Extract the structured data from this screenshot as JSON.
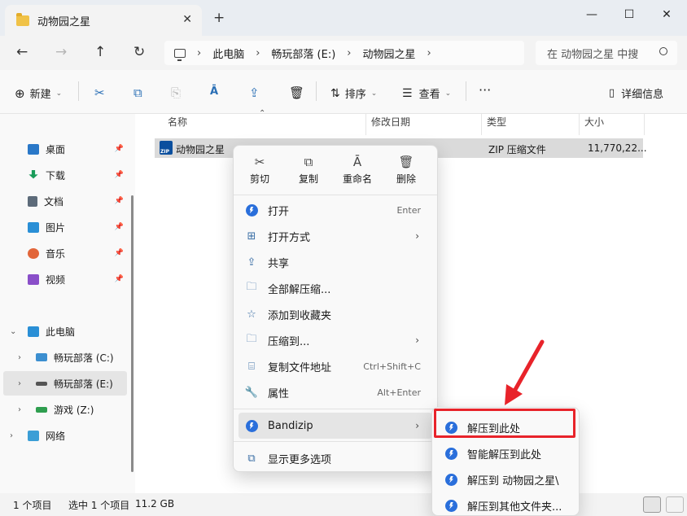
{
  "window": {
    "tab_title": "动物园之星",
    "new_tab": "+",
    "close_tab": "✕",
    "minimize": "—",
    "maximize": "☐",
    "close": "✕"
  },
  "address": {
    "crumbs": [
      "此电脑",
      "畅玩部落 (E:)",
      "动物园之星"
    ],
    "search_placeholder": "在 动物园之星 中搜"
  },
  "toolbar": {
    "new_label": "新建",
    "sort_label": "排序",
    "view_label": "查看",
    "more_label": "···",
    "details_label": "详细信息"
  },
  "sidebar": {
    "quick": [
      {
        "label": "桌面",
        "color": "#2a78c8"
      },
      {
        "label": "下载",
        "color": "#1a9c5a"
      },
      {
        "label": "文档",
        "color": "#5d6b7a"
      },
      {
        "label": "图片",
        "color": "#2a8fd6"
      },
      {
        "label": "音乐",
        "color": "#e2663a"
      },
      {
        "label": "视频",
        "color": "#8a4fc9"
      }
    ],
    "pc_label": "此电脑",
    "drives": [
      "畅玩部落 (C:)",
      "畅玩部落 (E:)",
      "游戏 (Z:)"
    ],
    "network_label": "网络"
  },
  "columns": [
    "名称",
    "修改日期",
    "类型",
    "大小"
  ],
  "file": {
    "name": "动物园之星",
    "type": "ZIP 压缩文件",
    "size": "11,770,22..."
  },
  "context_menu": {
    "quick_actions": [
      "剪切",
      "复制",
      "重命名",
      "删除"
    ],
    "items": [
      {
        "label": "打开",
        "shortcut": "Enter"
      },
      {
        "label": "打开方式",
        "submenu": "›"
      },
      {
        "label": "共享"
      },
      {
        "label": "全部解压缩..."
      },
      {
        "label": "添加到收藏夹"
      },
      {
        "label": "压缩到...",
        "submenu": "›"
      },
      {
        "label": "复制文件地址",
        "shortcut": "Ctrl+Shift+C"
      },
      {
        "label": "属性",
        "shortcut": "Alt+Enter"
      }
    ],
    "bandizip": "Bandizip",
    "bandizip_sub": "›",
    "more_options": "显示更多选项"
  },
  "bandizip_submenu": [
    "解压到此处",
    "智能解压到此处",
    "解压到 动物园之星\\",
    "解压到其他文件夹..."
  ],
  "status": {
    "count": "1 个项目",
    "selected": "选中 1 个项目",
    "size": "11.2 GB"
  },
  "colors": {
    "highlight": "#e8232a",
    "bandizip_blue": "#2a6fdb"
  }
}
